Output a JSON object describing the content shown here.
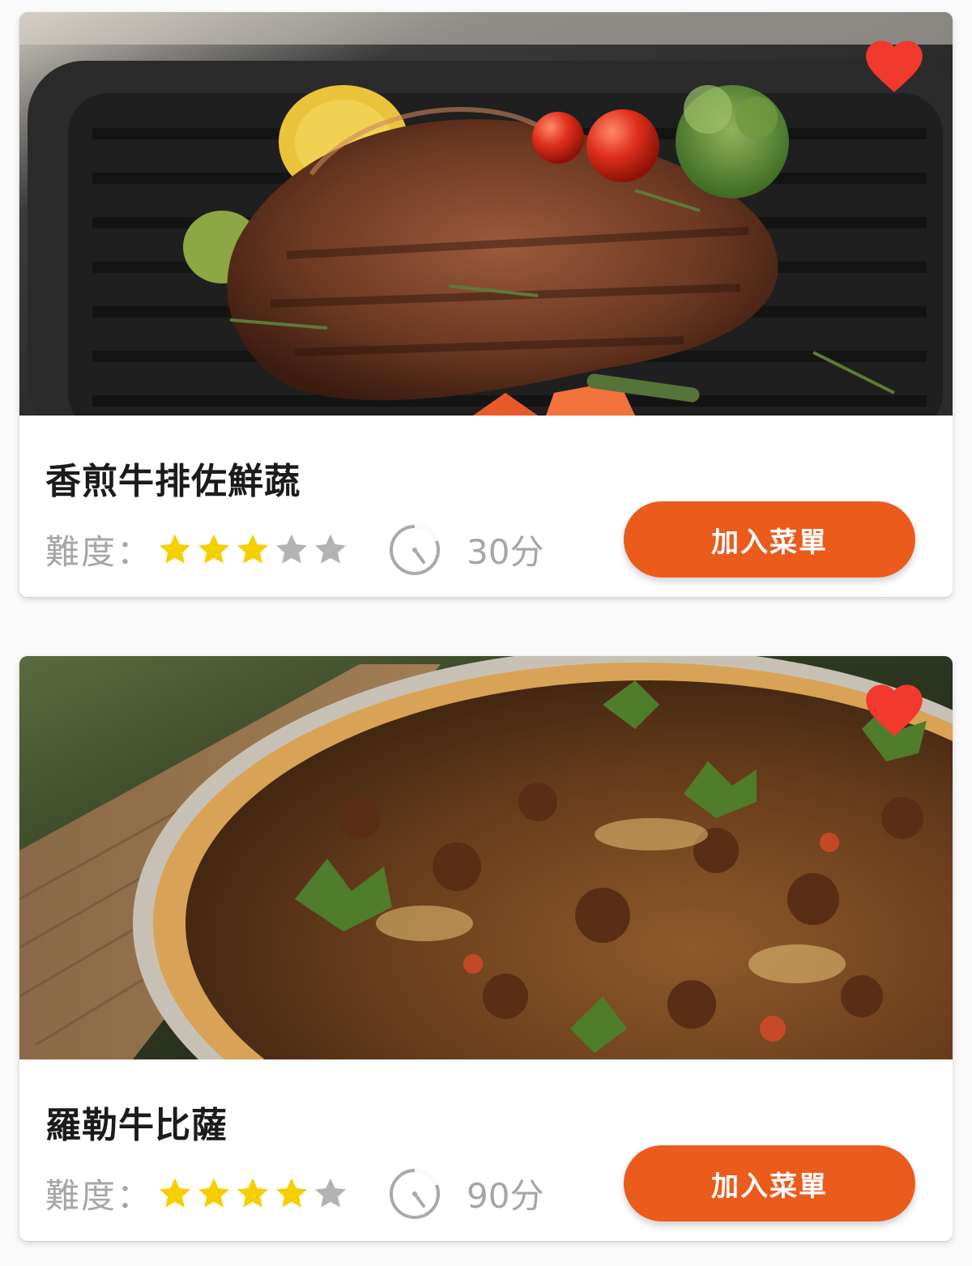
{
  "colors": {
    "accent": "#ea5b1c",
    "heart": "#f2392e",
    "star_on": "#f6cf00",
    "star_off": "#b3b3b3",
    "muted_text": "#a6a6a6"
  },
  "recipes": [
    {
      "title": "香煎牛排佐鮮蔬",
      "image_icon": "steak-photo",
      "favorite": true,
      "difficulty_label": "難度：",
      "difficulty": 3,
      "difficulty_max": 5,
      "time_icon": "timer-icon",
      "time": "30分",
      "button_label": "加入菜單"
    },
    {
      "title": "羅勒牛比薩",
      "image_icon": "pizza-photo",
      "favorite": true,
      "difficulty_label": "難度：",
      "difficulty": 4,
      "difficulty_max": 5,
      "time_icon": "timer-icon",
      "time": "90分",
      "button_label": "加入菜單"
    }
  ]
}
